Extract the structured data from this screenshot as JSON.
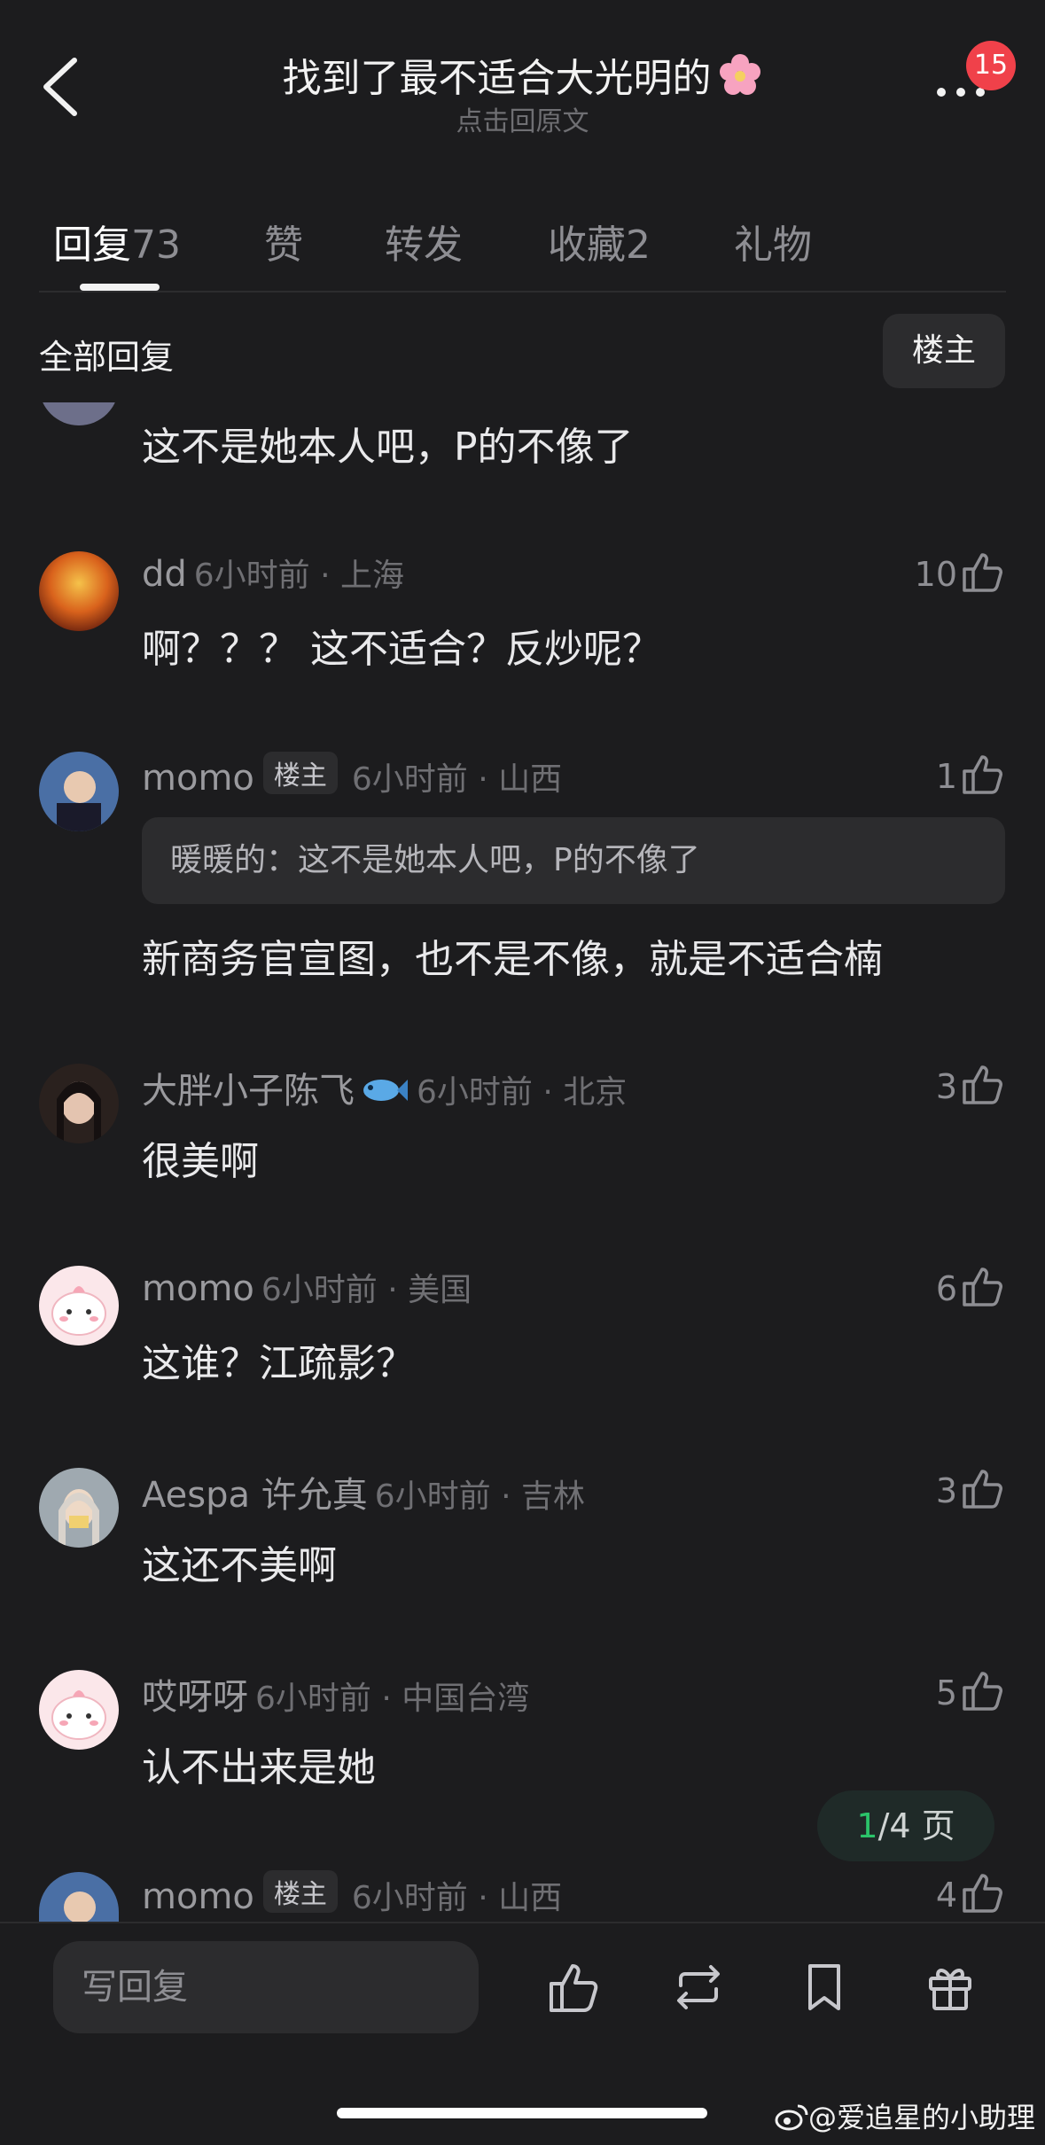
{
  "header": {
    "title": "找到了最不适合大光明的",
    "subtitle": "点击回原文",
    "notification_count": "15"
  },
  "tabs": [
    {
      "label": "回复",
      "count": "73"
    },
    {
      "label": "赞",
      "count": ""
    },
    {
      "label": "转发",
      "count": ""
    },
    {
      "label": "收藏",
      "count": "2"
    },
    {
      "label": "礼物",
      "count": ""
    }
  ],
  "section": {
    "title": "全部回复",
    "filter_label": "楼主"
  },
  "comments": [
    {
      "name": "",
      "owner": false,
      "meta": "",
      "text": "这不是她本人吧，P的不像了",
      "likes": ""
    },
    {
      "name": "dd",
      "owner": false,
      "meta": "6小时前 · 上海",
      "text": "啊？？？ 这不适合？反炒呢？",
      "likes": "10"
    },
    {
      "name": "momo",
      "owner": true,
      "owner_label": "楼主",
      "meta": "6小时前 · 山西",
      "quote": "暖暖的：这不是她本人吧，P的不像了",
      "text": "新商务官宣图，也不是不像，就是不适合楠",
      "likes": "1"
    },
    {
      "name": "大胖小子陈飞",
      "owner": false,
      "meta": "6小时前 · 北京",
      "text": "很美啊",
      "likes": "3"
    },
    {
      "name": "momo",
      "owner": false,
      "meta": "6小时前 · 美国",
      "text": "这谁？江疏影？",
      "likes": "6"
    },
    {
      "name": "Aespa 许允真",
      "owner": false,
      "meta": "6小时前 · 吉林",
      "text": "这还不美啊",
      "likes": "3"
    },
    {
      "name": "哎呀呀",
      "owner": false,
      "meta": "6小时前 · 中国台湾",
      "text": "认不出来是她",
      "likes": "5"
    },
    {
      "name": "momo",
      "owner": true,
      "owner_label": "楼主",
      "meta": "6小时前 · 山西",
      "text": "",
      "likes": "4"
    }
  ],
  "pager": {
    "current": "1",
    "total_text": "/4 页"
  },
  "bottom_bar": {
    "reply_placeholder": "写回复",
    "icons": [
      "like-icon",
      "repost-icon",
      "bookmark-icon",
      "gift-icon"
    ]
  },
  "watermark": "@爱追星的小助理",
  "colors": {
    "background": "#1c1c1e",
    "badge": "#f0414a",
    "pager_current": "#2bc46a"
  }
}
